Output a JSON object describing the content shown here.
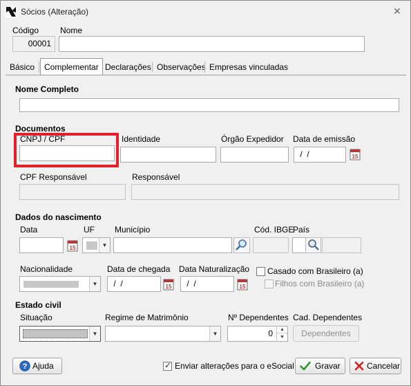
{
  "window": {
    "title": "Sócios (Alteração)",
    "close_glyph": "✕",
    "icon": "app-logo-icon"
  },
  "header": {
    "codigo_label": "Código",
    "codigo_value": "00001",
    "nome_label": "Nome",
    "nome_value": ""
  },
  "tabs": [
    {
      "label": "Básico",
      "active": false
    },
    {
      "label": "Complementar",
      "active": true
    },
    {
      "label": "Declarações",
      "active": false
    },
    {
      "label": "Observações",
      "active": false
    },
    {
      "label": "Empresas vinculadas",
      "active": false
    }
  ],
  "form": {
    "nome_completo_label": "Nome Completo",
    "nome_completo_value": "",
    "documentos_section": "Documentos",
    "cnpj_cpf_label": "CNPJ / CPF",
    "cnpj_cpf_value": "",
    "identidade_label": "Identidade",
    "identidade_value": "",
    "orgao_label": "Órgão Expedidor",
    "orgao_value": "",
    "data_emissao_label": "Data de emissão",
    "data_emissao_value": " /  /",
    "cpf_responsavel_label": "CPF Responsável",
    "responsavel_label": "Responsável",
    "nascimento_section": "Dados do nascimento",
    "data_label": "Data",
    "uf_label": "UF",
    "municipio_label": "Município",
    "municipio_value": "",
    "cod_ibge_label": "Cód. IBGE",
    "pais_label": "País",
    "nacionalidade_label": "Nacionalidade",
    "data_chegada_label": "Data de chegada",
    "data_chegada_value": " /  /",
    "data_naturalizacao_label": "Data Naturalização",
    "data_naturalizacao_value": " /  /",
    "casado_label": "Casado com Brasileiro (a)",
    "casado_checked": false,
    "filhos_label": "Filhos com Brasileiro (a)",
    "filhos_checked": false,
    "estado_civil_section": "Estado civil",
    "situacao_label": "Situação",
    "regime_label": "Regime de Matrimônio",
    "dependentes_label": "Nº Dependentes",
    "dependentes_value": "0",
    "cad_dependentes_label": "Cad. Dependentes",
    "dependentes_button": "Dependentes"
  },
  "footer": {
    "ajuda_label": "Ajuda",
    "esocial_label": "Enviar alterações para o eSocial",
    "esocial_checked": true,
    "gravar_label": "Gravar",
    "cancelar_label": "Cancelar"
  },
  "colors": {
    "highlight": "#e3202a",
    "window_bg": "#f0f0f0",
    "field_border": "#a9a9a9"
  }
}
